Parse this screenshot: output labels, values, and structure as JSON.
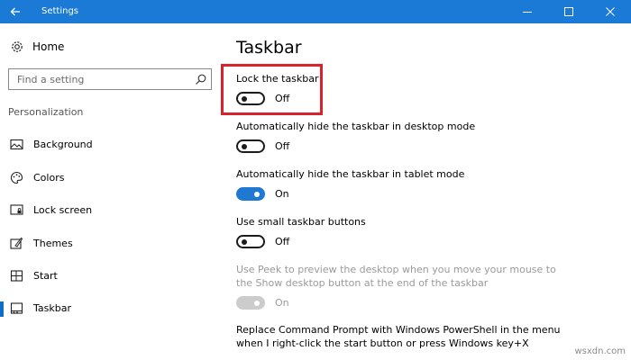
{
  "window": {
    "title": "Settings"
  },
  "sidebar": {
    "home_label": "Home",
    "search": {
      "placeholder": "Find a setting"
    },
    "section_label": "Personalization",
    "items": [
      {
        "label": "Background",
        "icon": "image-icon"
      },
      {
        "label": "Colors",
        "icon": "palette-icon"
      },
      {
        "label": "Lock screen",
        "icon": "lock-screen-icon"
      },
      {
        "label": "Themes",
        "icon": "themes-icon"
      },
      {
        "label": "Start",
        "icon": "start-icon"
      },
      {
        "label": "Taskbar",
        "icon": "taskbar-icon",
        "active": true
      }
    ]
  },
  "main": {
    "title": "Taskbar",
    "settings": [
      {
        "label": "Lock the taskbar",
        "state": "Off",
        "on": false,
        "enabled": true
      },
      {
        "label": "Automatically hide the taskbar in desktop mode",
        "state": "Off",
        "on": false,
        "enabled": true
      },
      {
        "label": "Automatically hide the taskbar in tablet mode",
        "state": "On",
        "on": true,
        "enabled": true
      },
      {
        "label": "Use small taskbar buttons",
        "state": "Off",
        "on": false,
        "enabled": true
      },
      {
        "label_line1": "Use Peek to preview the desktop when you move your mouse to",
        "label_line2": "the Show desktop button at the end of the taskbar",
        "state": "On",
        "on": true,
        "enabled": false
      },
      {
        "label_line1": "Replace Command Prompt with Windows PowerShell in the menu",
        "label_line2": "when I right-click the start button or press Windows key+X"
      }
    ]
  },
  "colors": {
    "accent": "#1a7ad6",
    "highlight": "#d9232c",
    "toggle_on": "#1f78d1"
  },
  "watermark": "wsxdn.com"
}
